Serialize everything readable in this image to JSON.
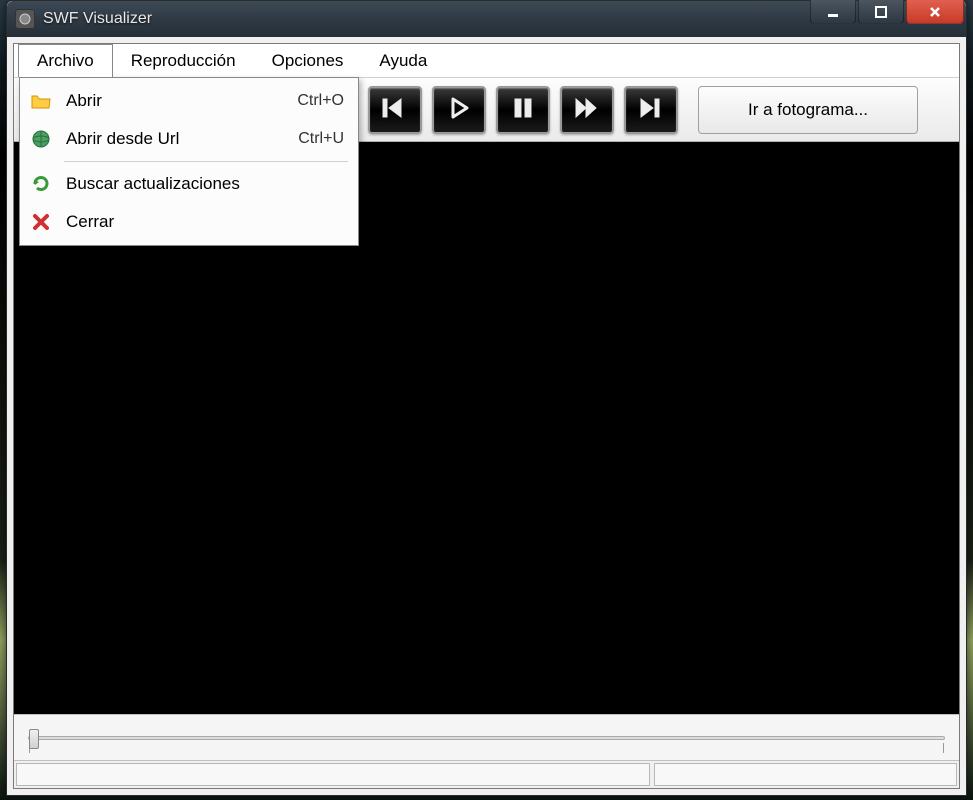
{
  "window": {
    "title": "SWF Visualizer"
  },
  "menubar": {
    "items": [
      {
        "label": "Archivo"
      },
      {
        "label": "Reproducción"
      },
      {
        "label": "Opciones"
      },
      {
        "label": "Ayuda"
      }
    ]
  },
  "dropdown": {
    "items": [
      {
        "icon": "folder-open-icon",
        "label": "Abrir",
        "shortcut": "Ctrl+O"
      },
      {
        "icon": "globe-icon",
        "label": "Abrir desde Url",
        "shortcut": "Ctrl+U"
      },
      {
        "icon": "refresh-icon",
        "label": "Buscar actualizaciones",
        "shortcut": ""
      },
      {
        "icon": "close-x-icon",
        "label": "Cerrar",
        "shortcut": ""
      }
    ]
  },
  "toolbar": {
    "goto_label": "Ir a fotograma..."
  }
}
